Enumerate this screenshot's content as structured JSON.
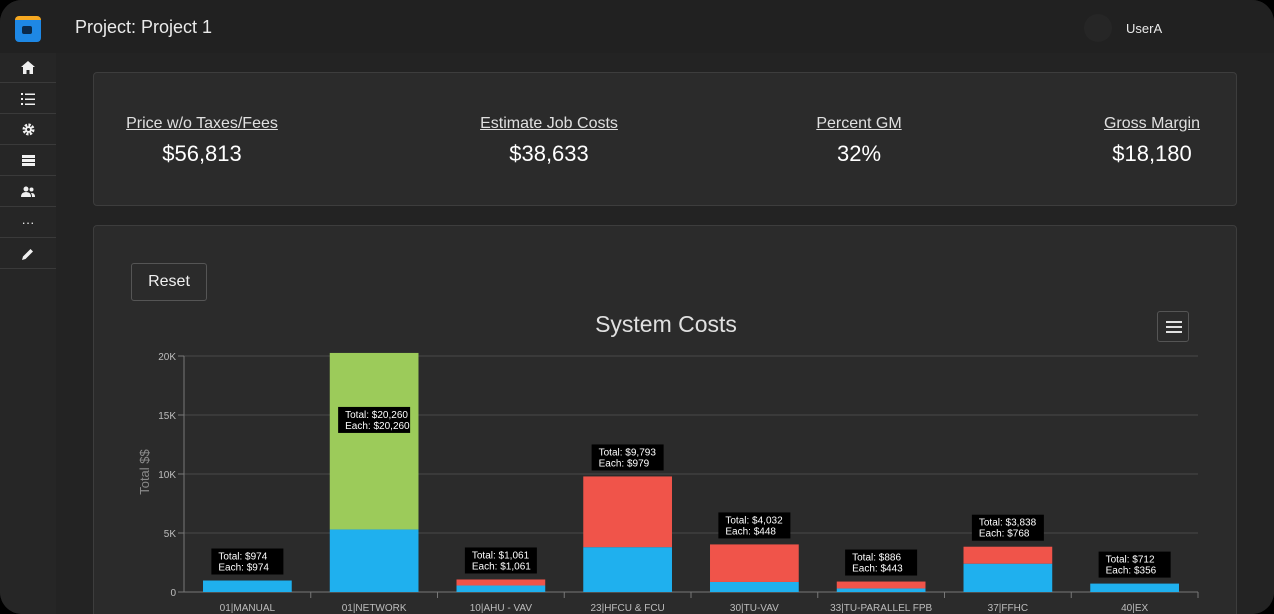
{
  "header": {
    "project_title": "Project: Project 1",
    "user_name": "UserA"
  },
  "sidebar": {
    "items": [
      {
        "name": "home",
        "icon": "home-icon"
      },
      {
        "name": "list",
        "icon": "list-icon"
      },
      {
        "name": "settings",
        "icon": "gear-icon"
      },
      {
        "name": "database",
        "icon": "database-icon"
      },
      {
        "name": "users",
        "icon": "users-icon"
      },
      {
        "name": "more",
        "icon": "more-icon",
        "label": "···"
      },
      {
        "name": "edit",
        "icon": "pencil-icon"
      }
    ]
  },
  "kpis": [
    {
      "label": "Price w/o Taxes/Fees",
      "value": "$56,813"
    },
    {
      "label": "Estimate Job Costs",
      "value": "$38,633"
    },
    {
      "label": "Percent GM",
      "value": "32%"
    },
    {
      "label": "Gross Margin",
      "value": "$18,180"
    }
  ],
  "chart_controls": {
    "reset_label": "Reset"
  },
  "colors": {
    "blue": "#1fb0ee",
    "green": "#9ccb5a",
    "red": "#f0544a"
  },
  "chart_data": {
    "type": "bar",
    "stacked": true,
    "title": "System Costs",
    "ylabel": "Total $$",
    "ylim": [
      0,
      20000
    ],
    "yticks": [
      "0",
      "5K",
      "10K",
      "15K",
      "20K"
    ],
    "yticks_values": [
      0,
      5000,
      10000,
      15000,
      20000
    ],
    "grid": true,
    "categories": [
      "01|MANUAL",
      "01|NETWORK",
      "10|AHU - VAV",
      "23|HFCU & FCU",
      "30|TU-VAV",
      "33|TU-PARALLEL FPB",
      "37|FFHC",
      "40|EX"
    ],
    "series": [
      {
        "color": "#1fb0ee",
        "values": [
          974,
          5300,
          550,
          3800,
          850,
          300,
          2400,
          712
        ]
      },
      {
        "color": "#9ccb5a",
        "values": [
          0,
          14960,
          0,
          0,
          0,
          0,
          0,
          0
        ]
      },
      {
        "color": "#f0544a",
        "values": [
          0,
          0,
          511,
          5993,
          3182,
          586,
          1438,
          0
        ]
      }
    ],
    "data_labels": [
      {
        "total": "Total: $974",
        "each": "Each: $974"
      },
      {
        "total": "Total: $20,260",
        "each": "Each: $20,260"
      },
      {
        "total": "Total: $1,061",
        "each": "Each: $1,061"
      },
      {
        "total": "Total: $9,793",
        "each": "Each: $979"
      },
      {
        "total": "Total: $4,032",
        "each": "Each: $448"
      },
      {
        "total": "Total: $886",
        "each": "Each: $443"
      },
      {
        "total": "Total: $3,838",
        "each": "Each: $768"
      },
      {
        "total": "Total: $712",
        "each": "Each: $356"
      }
    ]
  }
}
